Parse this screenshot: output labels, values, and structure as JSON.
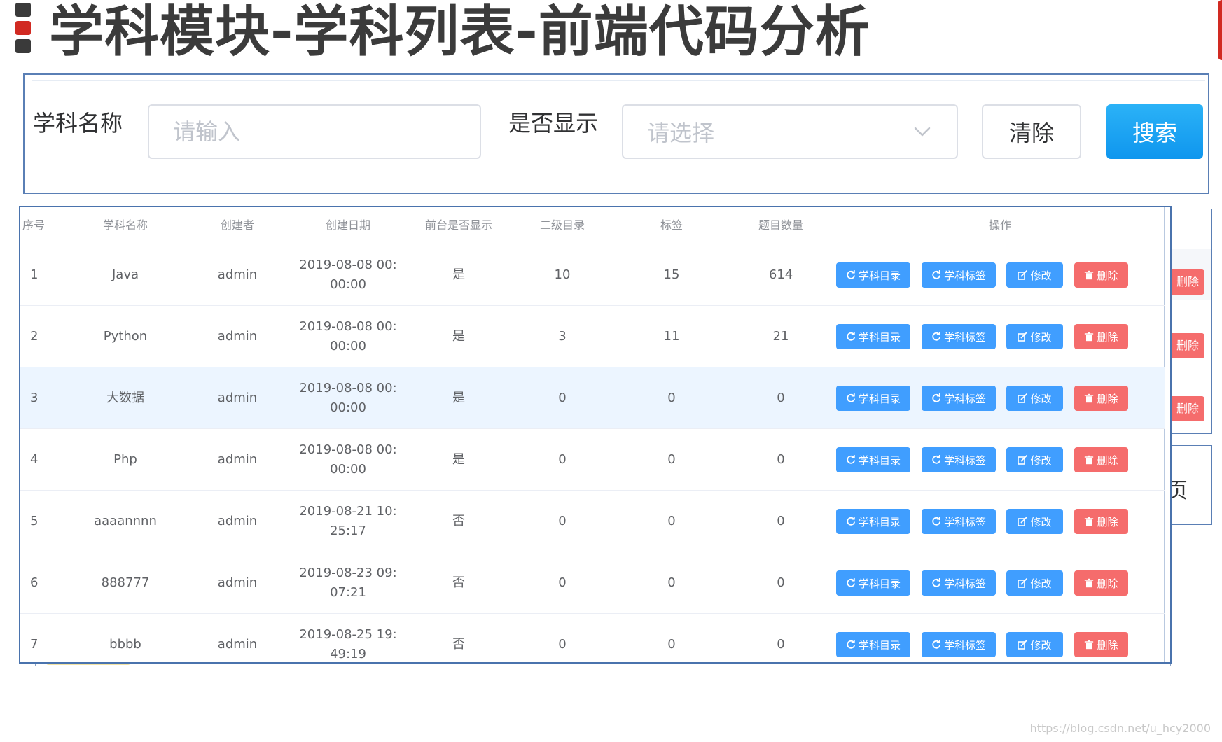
{
  "slide": {
    "title": "学科模块-学科列表-前端代码分析"
  },
  "search": {
    "name_label": "学科名称",
    "name_placeholder": "请输入",
    "show_label": "是否显示",
    "show_placeholder": "请选择",
    "clear_label": "清除",
    "search_label": "搜索"
  },
  "table": {
    "headers": [
      "序号",
      "学科名称",
      "创建者",
      "创建日期",
      "前台是否显示",
      "二级目录",
      "标签",
      "题目数量",
      "操作"
    ],
    "action_labels": {
      "catalog": "学科目录",
      "tags": "学科标签",
      "edit": "修改",
      "delete": "删除"
    },
    "rows": [
      {
        "index": "1",
        "name": "Java",
        "creator": "admin",
        "date_line1": "2019-08-08 00:",
        "date_line2": "00:00",
        "show": "是",
        "catalogs": "10",
        "tags": "15",
        "questions": "614"
      },
      {
        "index": "2",
        "name": "Python",
        "creator": "admin",
        "date_line1": "2019-08-08 00:",
        "date_line2": "00:00",
        "show": "是",
        "catalogs": "3",
        "tags": "11",
        "questions": "21"
      },
      {
        "index": "3",
        "name": "大数据",
        "creator": "admin",
        "date_line1": "2019-08-08 00:",
        "date_line2": "00:00",
        "show": "是",
        "catalogs": "0",
        "tags": "0",
        "questions": "0"
      },
      {
        "index": "4",
        "name": "Php",
        "creator": "admin",
        "date_line1": "2019-08-08 00:",
        "date_line2": "00:00",
        "show": "是",
        "catalogs": "0",
        "tags": "0",
        "questions": "0"
      },
      {
        "index": "5",
        "name": "aaaannnn",
        "creator": "admin",
        "date_line1": "2019-08-21 10:",
        "date_line2": "25:17",
        "show": "否",
        "catalogs": "0",
        "tags": "0",
        "questions": "0"
      },
      {
        "index": "6",
        "name": "888777",
        "creator": "admin",
        "date_line1": "2019-08-23 09:",
        "date_line2": "07:21",
        "show": "否",
        "catalogs": "0",
        "tags": "0",
        "questions": "0"
      },
      {
        "index": "7",
        "name": "bbbb",
        "creator": "admin",
        "date_line1": "2019-08-25 19:",
        "date_line2": "49:19",
        "show": "否",
        "catalogs": "0",
        "tags": "0",
        "questions": "0"
      }
    ]
  },
  "background": {
    "delete_fragment": "删除",
    "side_fragment": "页"
  },
  "icons": {
    "title_mark": "title-bullet-icon",
    "select_arrow": "chevron-down-icon",
    "catalog": "refresh-icon",
    "tags": "refresh-icon",
    "edit": "edit-icon",
    "delete": "trash-icon"
  },
  "colors": {
    "primary": "#409eff",
    "danger": "#f56c6c",
    "search_button": "#1a9ff0",
    "highlight_row": "#ecf5ff",
    "panel_border": "#4a73ad",
    "title_accent": "#d12a22"
  },
  "watermark": "https://blog.csdn.net/u_hcy2000"
}
